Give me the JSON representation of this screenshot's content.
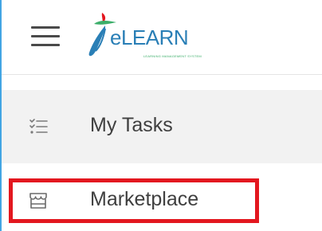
{
  "header": {
    "menu_icon": "hamburger-menu-icon",
    "logo": {
      "text": "eLEARN",
      "tagline": "LEARNING MANAGEMENT SYSTEM",
      "colors": {
        "primary": "#2a7fb6",
        "accent_red": "#e3171f",
        "accent_green": "#3cae6a"
      }
    }
  },
  "nav": {
    "items": [
      {
        "label": "My Tasks",
        "icon": "task-list-icon",
        "selected": true
      },
      {
        "label": "Marketplace",
        "icon": "storefront-icon",
        "selected": false
      }
    ]
  },
  "annotation": {
    "highlight_color": "#e3171f",
    "highlight_target": "Marketplace"
  }
}
